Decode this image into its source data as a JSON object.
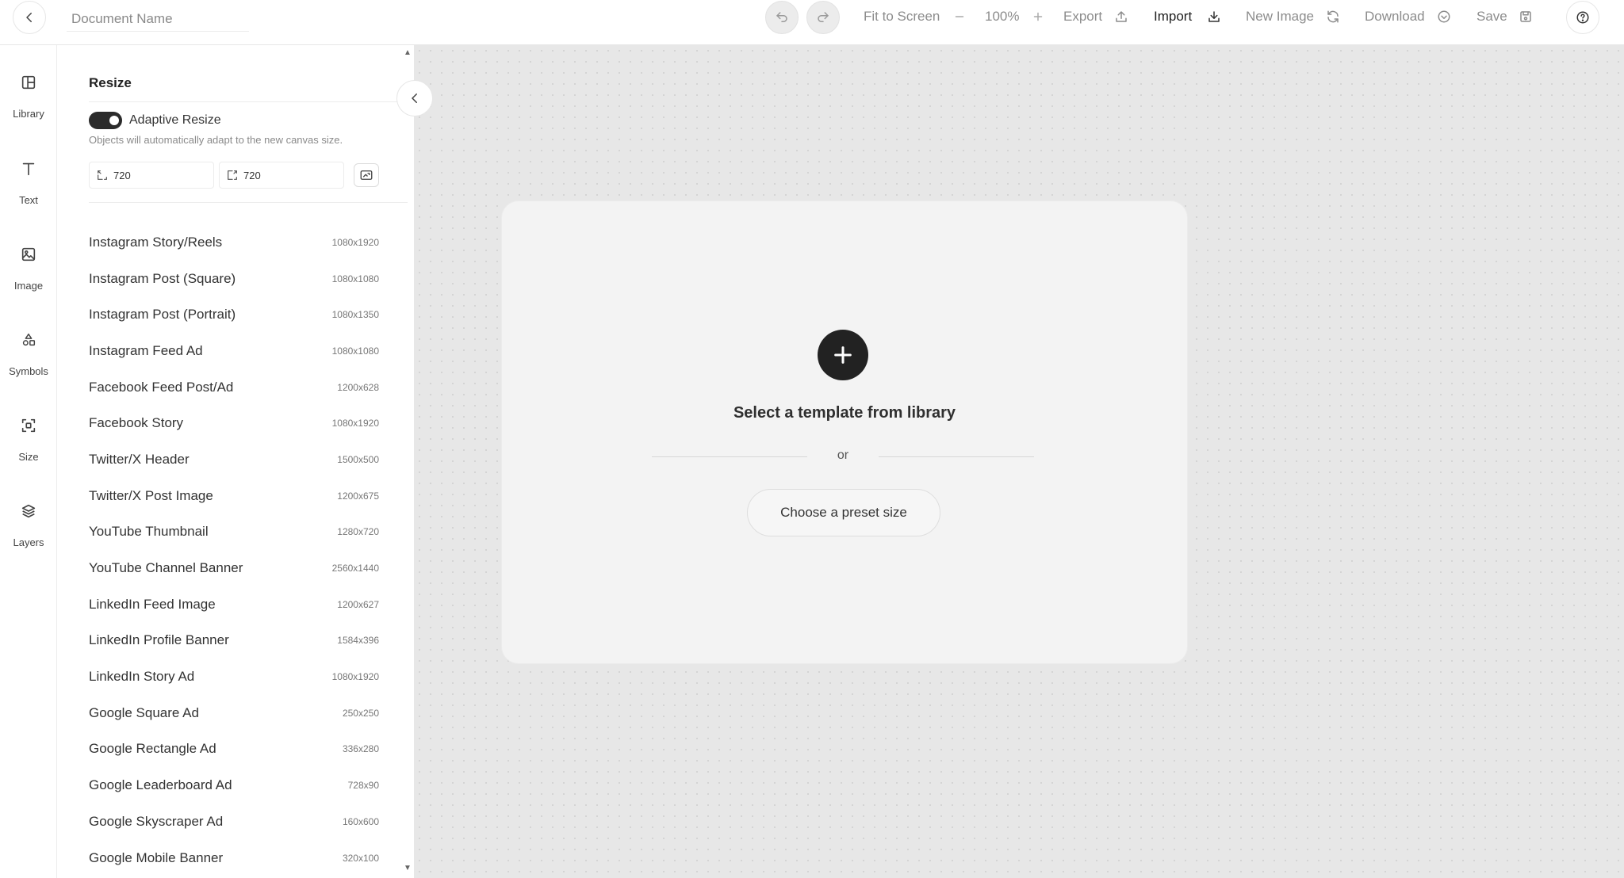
{
  "topbar": {
    "doc_name_placeholder": "Document Name",
    "fit_to_screen": "Fit to Screen",
    "zoom": "100%",
    "export": "Export",
    "import": "Import",
    "new_image": "New Image",
    "download": "Download",
    "save": "Save"
  },
  "rail": {
    "items": [
      {
        "label": "Library",
        "icon": "library-icon"
      },
      {
        "label": "Text",
        "icon": "text-icon"
      },
      {
        "label": "Image",
        "icon": "image-icon"
      },
      {
        "label": "Symbols",
        "icon": "symbols-icon"
      },
      {
        "label": "Size",
        "icon": "size-icon"
      },
      {
        "label": "Layers",
        "icon": "layers-icon"
      }
    ]
  },
  "panel": {
    "title": "Resize",
    "adaptive_label": "Adaptive Resize",
    "adaptive_help": "Objects will automatically adapt to the new canvas size.",
    "adaptive_on": true,
    "width": "720",
    "height": "720",
    "presets": [
      {
        "name": "Instagram Story/Reels",
        "size": "1080x1920"
      },
      {
        "name": "Instagram Post (Square)",
        "size": "1080x1080"
      },
      {
        "name": "Instagram Post (Portrait)",
        "size": "1080x1350"
      },
      {
        "name": "Instagram Feed Ad",
        "size": "1080x1080"
      },
      {
        "name": "Facebook Feed Post/Ad",
        "size": "1200x628"
      },
      {
        "name": "Facebook Story",
        "size": "1080x1920"
      },
      {
        "name": "Twitter/X Header",
        "size": "1500x500"
      },
      {
        "name": "Twitter/X Post Image",
        "size": "1200x675"
      },
      {
        "name": "YouTube Thumbnail",
        "size": "1280x720"
      },
      {
        "name": "YouTube Channel Banner",
        "size": "2560x1440"
      },
      {
        "name": "LinkedIn Feed Image",
        "size": "1200x627"
      },
      {
        "name": "LinkedIn Profile Banner",
        "size": "1584x396"
      },
      {
        "name": "LinkedIn Story Ad",
        "size": "1080x1920"
      },
      {
        "name": "Google Square Ad",
        "size": "250x250"
      },
      {
        "name": "Google Rectangle Ad",
        "size": "336x280"
      },
      {
        "name": "Google Leaderboard Ad",
        "size": "728x90"
      },
      {
        "name": "Google Skyscraper Ad",
        "size": "160x600"
      },
      {
        "name": "Google Mobile Banner",
        "size": "320x100"
      }
    ]
  },
  "canvas": {
    "title": "Select a template from library",
    "or": "or",
    "preset_button": "Choose a preset size"
  },
  "colors": {
    "accent": "#222222",
    "canvas_bg": "#e7e7e7",
    "card_bg": "#f3f3f3"
  }
}
